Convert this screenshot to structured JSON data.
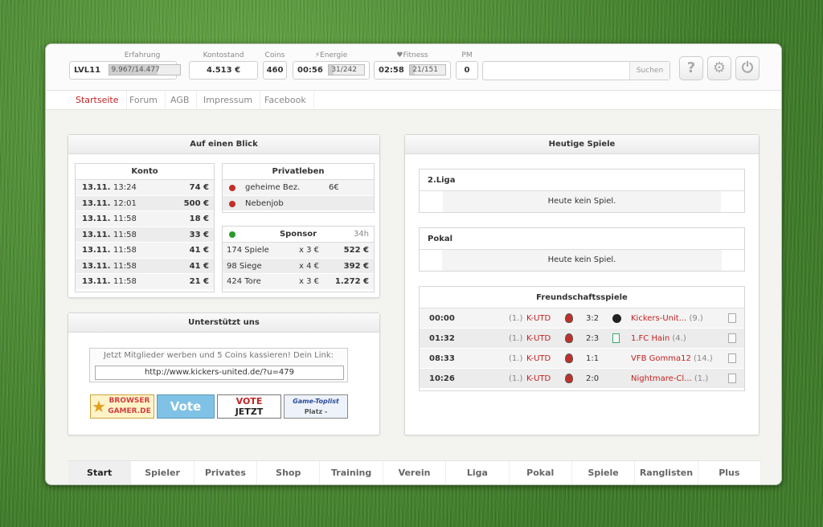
{
  "header": {
    "level": "LVL11",
    "erfahrung_label": "Erfahrung",
    "erfahrung_value": "9.967/14.477",
    "erfahrung_fraction": 0.69,
    "konto_label": "Kontostand",
    "konto_value": "4.513 €",
    "coins_label": "Coins",
    "coins_value": "460",
    "energie_label": "Energie",
    "energie_time": "00:56",
    "energie_value": "31/242",
    "energie_fraction": 0.13,
    "fitness_label": "Fitness",
    "fitness_time": "02:58",
    "fitness_value": "21/151",
    "fitness_fraction": 0.14,
    "pm_label": "PM",
    "pm_value": "0",
    "search_placeholder": "",
    "search_button": "Suchen",
    "icons": [
      "help-icon",
      "gear-icon",
      "power-icon"
    ]
  },
  "nav": [
    "Startseite",
    "Forum",
    "AGB",
    "Impressum",
    "Facebook"
  ],
  "blick": {
    "title": "Auf einen Blick",
    "konto_title": "Konto",
    "konto_rows": [
      {
        "date": "13.11.",
        "time": "13:24",
        "amount": "74 €"
      },
      {
        "date": "13.11.",
        "time": "12:01",
        "amount": "500 €"
      },
      {
        "date": "13.11.",
        "time": "11:58",
        "amount": "18 €"
      },
      {
        "date": "13.11.",
        "time": "11:58",
        "amount": "33 €"
      },
      {
        "date": "13.11.",
        "time": "11:58",
        "amount": "41 €"
      },
      {
        "date": "13.11.",
        "time": "11:58",
        "amount": "41 €"
      },
      {
        "date": "13.11.",
        "time": "11:58",
        "amount": "21 €"
      }
    ],
    "privat_title": "Privatleben",
    "privat_rows": [
      {
        "label": "geheime Bez.",
        "value": "6€"
      },
      {
        "label": "Nebenjob",
        "value": ""
      }
    ],
    "sponsor_title": "Sponsor",
    "sponsor_time": "34h",
    "sponsor_rows": [
      {
        "label": "174 Spiele",
        "mult": "x 3 €",
        "value": "522 €"
      },
      {
        "label": "98 Siege",
        "mult": "x 4 €",
        "value": "392 €"
      },
      {
        "label": "424 Tore",
        "mult": "x 3 €",
        "value": "1.272 €"
      }
    ]
  },
  "support": {
    "title": "Unterstützt uns",
    "text": "Jetzt Mitglieder werben und 5 Coins kassieren! Dein Link:",
    "link": "http://www.kickers-united.de/?u=479",
    "badges": [
      {
        "line1": "BROWSER",
        "line2": "GAMER.DE"
      },
      {
        "line1": "Vote",
        "line2": ""
      },
      {
        "line1": "VOTE",
        "line2": "JETZT"
      },
      {
        "line1": "Game-Toplist",
        "line2": "Platz -"
      }
    ]
  },
  "games": {
    "title": "Heutige Spiele",
    "liga_title": "2.Liga",
    "liga_text": "Heute kein Spiel.",
    "pokal_title": "Pokal",
    "pokal_text": "Heute kein Spiel.",
    "friendly_title": "Freundschaftsspiele",
    "friendly_rows": [
      {
        "time": "00:00",
        "home_rank": "(1.)",
        "home": "K-UTD",
        "score": "3:2",
        "away": "Kickers-Unit...",
        "away_rank": "(9.)",
        "away_crest": "black"
      },
      {
        "time": "01:32",
        "home_rank": "(1.)",
        "home": "K-UTD",
        "score": "2:3",
        "away": "1.FC Hain",
        "away_rank": "(4.)",
        "away_crest": "green"
      },
      {
        "time": "08:33",
        "home_rank": "(1.)",
        "home": "K-UTD",
        "score": "1:1",
        "away": "VFB Gomma12",
        "away_rank": "(14.)",
        "away_crest": "none"
      },
      {
        "time": "10:26",
        "home_rank": "(1.)",
        "home": "K-UTD",
        "score": "2:0",
        "away": "Nightmare-Cl...",
        "away_rank": "(1.)",
        "away_crest": "none"
      }
    ]
  },
  "bottom_nav": [
    "Start",
    "Spieler",
    "Privates",
    "Shop",
    "Training",
    "Verein",
    "Liga",
    "Pokal",
    "Spiele",
    "Ranglisten",
    "Plus"
  ],
  "colors": {
    "accent": "#c32222",
    "grass": "#4f8f33"
  }
}
